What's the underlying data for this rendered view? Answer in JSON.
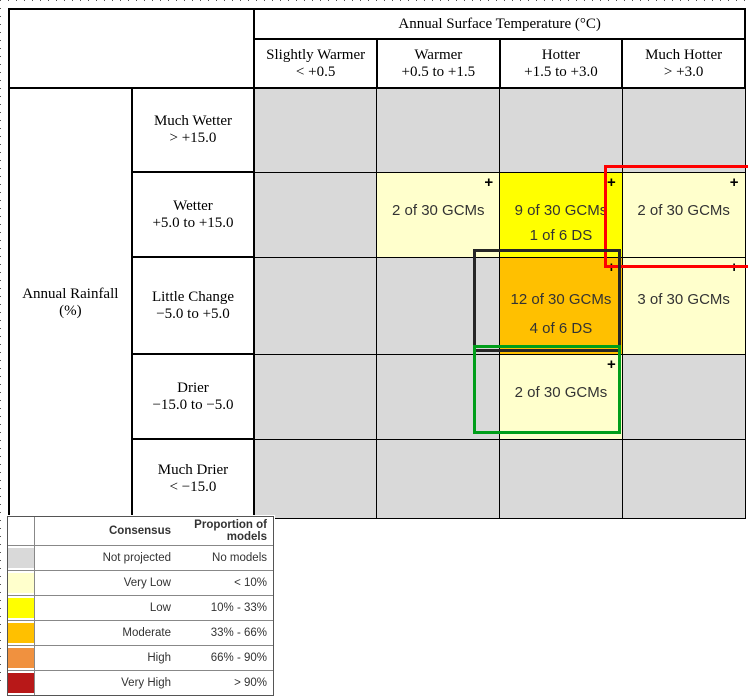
{
  "chart_data": {
    "type": "heatmap",
    "title": "Annual Surface Temperature (°C)",
    "xlabel": "Annual Surface Temperature (°C)",
    "ylabel": "Annual Rainfall (%)",
    "categories": [
      "Slightly Warmer\n< +0.5",
      "Warmer\n+0.5 to +1.5",
      "Hotter\n+1.5 to +3.0",
      "Much Hotter\n> +3.0"
    ],
    "rows": [
      "Much Wetter\n> +15.0",
      "Wetter\n+5.0 to +15.0",
      "Little Change\n-5.0 to +5.0",
      "Drier\n-15.0 to -5.0",
      "Much Drier\n< -15.0"
    ],
    "cells": [
      [
        {
          "gcm": null,
          "ds": null,
          "level": "none"
        },
        {
          "gcm": null,
          "ds": null,
          "level": "none"
        },
        {
          "gcm": null,
          "ds": null,
          "level": "none"
        },
        {
          "gcm": null,
          "ds": null,
          "level": "none"
        }
      ],
      [
        {
          "gcm": null,
          "ds": null,
          "level": "none"
        },
        {
          "gcm": 2,
          "ds": null,
          "level": "verylow"
        },
        {
          "gcm": 9,
          "ds": 1,
          "level": "low"
        },
        {
          "gcm": 2,
          "ds": null,
          "level": "verylow"
        }
      ],
      [
        {
          "gcm": null,
          "ds": null,
          "level": "none"
        },
        {
          "gcm": null,
          "ds": null,
          "level": "none"
        },
        {
          "gcm": 12,
          "ds": 4,
          "level": "moderate"
        },
        {
          "gcm": 3,
          "ds": null,
          "level": "verylow"
        }
      ],
      [
        {
          "gcm": null,
          "ds": null,
          "level": "none"
        },
        {
          "gcm": null,
          "ds": null,
          "level": "none"
        },
        {
          "gcm": 2,
          "ds": null,
          "level": "verylow"
        },
        {
          "gcm": null,
          "ds": null,
          "level": "none"
        }
      ],
      [
        {
          "gcm": null,
          "ds": null,
          "level": "none"
        },
        {
          "gcm": null,
          "ds": null,
          "level": "none"
        },
        {
          "gcm": null,
          "ds": null,
          "level": "none"
        },
        {
          "gcm": null,
          "ds": null,
          "level": "none"
        }
      ]
    ],
    "total_gcms": 30,
    "total_ds": 6,
    "legend_position": "bottom-left",
    "grid": true
  },
  "matrix": {
    "column_group_header": "Annual Surface Temperature (°C)",
    "row_group_header": "Annual Rainfall (%)",
    "columns": [
      {
        "name": "Slightly Warmer",
        "range": "< +0.5"
      },
      {
        "name": "Warmer",
        "range": "+0.5 to +1.5"
      },
      {
        "name": "Hotter",
        "range": "+1.5 to +3.0"
      },
      {
        "name": "Much Hotter",
        "range": "> +3.0"
      }
    ],
    "rows": [
      {
        "name": "Much Wetter",
        "range": "> +15.0"
      },
      {
        "name": "Wetter",
        "range": "+5.0 to +15.0"
      },
      {
        "name": "Little Change",
        "range": "−5.0 to +5.0"
      },
      {
        "name": "Drier",
        "range": "−15.0 to −5.0"
      },
      {
        "name": "Much Drier",
        "range": "< −15.0"
      }
    ],
    "cells": {
      "r1c1": {
        "line1": "",
        "line2": "",
        "plus": ""
      },
      "r1c2": {
        "line1": "",
        "line2": "",
        "plus": ""
      },
      "r1c3": {
        "line1": "",
        "line2": "",
        "plus": ""
      },
      "r1c4": {
        "line1": "",
        "line2": "",
        "plus": ""
      },
      "r2c1": {
        "line1": "",
        "line2": "",
        "plus": ""
      },
      "r2c2": {
        "line1": "2 of 30 GCMs",
        "line2": "",
        "plus": "+"
      },
      "r2c3": {
        "line1": "9 of 30 GCMs",
        "line2": "1 of 6 DS",
        "plus": "+"
      },
      "r2c4": {
        "line1": "2 of 30 GCMs",
        "line2": "",
        "plus": "+"
      },
      "r3c1": {
        "line1": "",
        "line2": "",
        "plus": ""
      },
      "r3c2": {
        "line1": "",
        "line2": "",
        "plus": ""
      },
      "r3c3": {
        "line1": "12 of 30 GCMs",
        "line2": "4 of 6 DS",
        "plus": "+"
      },
      "r3c4": {
        "line1": "3 of 30 GCMs",
        "line2": "",
        "plus": "+"
      },
      "r4c1": {
        "line1": "",
        "line2": "",
        "plus": ""
      },
      "r4c2": {
        "line1": "",
        "line2": "",
        "plus": ""
      },
      "r4c3": {
        "line1": "2 of 30 GCMs",
        "line2": "",
        "plus": "+"
      },
      "r4c4": {
        "line1": "",
        "line2": "",
        "plus": ""
      },
      "r5c1": {
        "line1": "",
        "line2": "",
        "plus": ""
      },
      "r5c2": {
        "line1": "",
        "line2": "",
        "plus": ""
      },
      "r5c3": {
        "line1": "",
        "line2": "",
        "plus": ""
      },
      "r5c4": {
        "line1": "",
        "line2": "",
        "plus": ""
      }
    }
  },
  "legend": {
    "header": {
      "consensus": "Consensus",
      "proportion": "Proportion of models"
    },
    "rows": [
      {
        "consensus": "Not projected",
        "proportion": "No models",
        "color": "#d9d9d9"
      },
      {
        "consensus": "Very Low",
        "proportion": "< 10%",
        "color": "#ffffcc"
      },
      {
        "consensus": "Low",
        "proportion": "10% - 33%",
        "color": "#ffff00"
      },
      {
        "consensus": "Moderate",
        "proportion": "33% - 66%",
        "color": "#ffc000"
      },
      {
        "consensus": "High",
        "proportion": "66% - 90%",
        "color": "#f0913f"
      },
      {
        "consensus": "Very High",
        "proportion": "> 90%",
        "color": "#b81818"
      }
    ]
  },
  "highlights": {
    "red": {
      "color": "#ff0000"
    },
    "black": {
      "color": "#262626"
    },
    "green": {
      "color": "#009e1a"
    }
  }
}
